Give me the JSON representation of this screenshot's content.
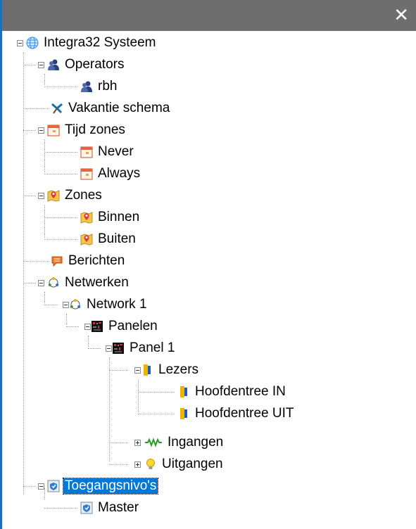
{
  "window": {
    "close_glyph": "✕"
  },
  "tree": {
    "root": "Integra32 Systeem",
    "operators": "Operators",
    "op_rbh": "rbh",
    "vakantie": "Vakantie schema",
    "tijdzones": "Tijd zones",
    "tz_never": "Never",
    "tz_always": "Always",
    "zones": "Zones",
    "z_binnen": "Binnen",
    "z_buiten": "Buiten",
    "berichten": "Berichten",
    "netwerken": "Netwerken",
    "network1": "Network 1",
    "panelen": "Panelen",
    "panel1": "Panel 1",
    "lezers": "Lezers",
    "lz_in": "Hoofdentree IN",
    "lz_uit": "Hoofdentree UIT",
    "ingangen": "Ingangen",
    "uitgangen": "Uitgangen",
    "toegangsnivos": "Toegangsnivo's",
    "master": "Master"
  },
  "selected_node": "Toegangsnivo's",
  "colors": {
    "selection": "#0078d7",
    "titlebar": "#6e6e6e",
    "border": "#1e6fb8"
  }
}
